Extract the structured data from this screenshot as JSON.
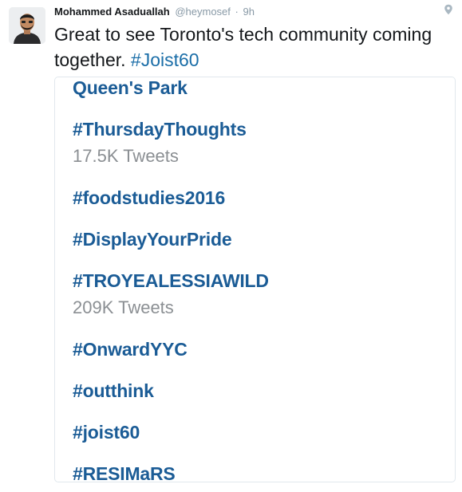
{
  "tweet": {
    "author_name": "Mohammed Asaduallah",
    "handle": "@heymosef",
    "separator": "·",
    "time": "9h",
    "text_prefix": "Great to see Toronto's tech community coming together. ",
    "hashtag": "#Joist60",
    "avatar_icon": "user-avatar",
    "location_icon": "geo-pin-icon"
  },
  "trends": [
    {
      "name": "Queen's Park",
      "count": ""
    },
    {
      "name": "#ThursdayThoughts",
      "count": "17.5K Tweets"
    },
    {
      "name": "#foodstudies2016",
      "count": ""
    },
    {
      "name": "#DisplayYourPride",
      "count": ""
    },
    {
      "name": "#TROYEALESSIAWILD",
      "count": "209K Tweets"
    },
    {
      "name": "#OnwardYYC",
      "count": ""
    },
    {
      "name": "#outthink",
      "count": ""
    },
    {
      "name": "#joist60",
      "count": ""
    },
    {
      "name": "#RESIMaRS",
      "count": ""
    }
  ],
  "colors": {
    "link": "#1b6ea8",
    "trend_link": "#1b5c96",
    "meta_gray": "#8899a6",
    "count_gray": "#8b8f93"
  }
}
